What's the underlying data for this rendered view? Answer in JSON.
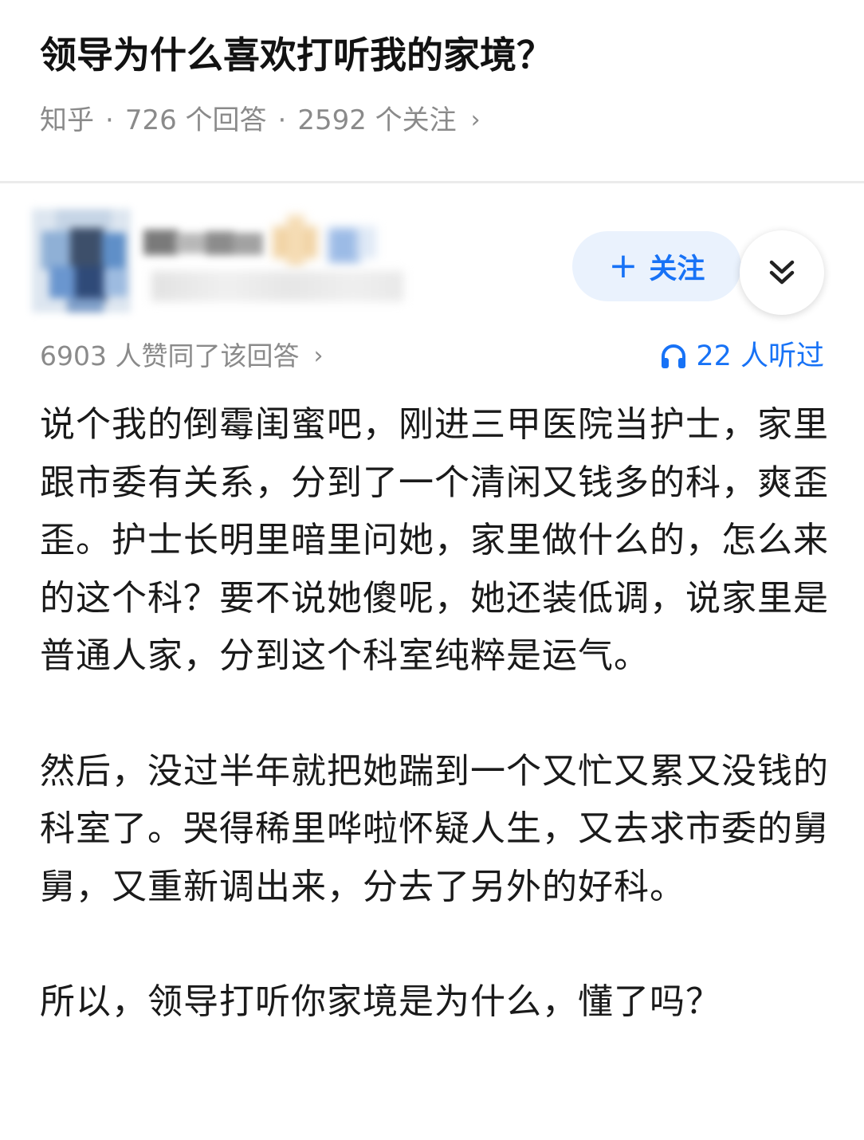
{
  "question": {
    "title": "领导为什么喜欢打听我的家境？",
    "source": "知乎",
    "answers": "726 个回答",
    "followers": "2592 个关注",
    "separator": "·",
    "chevron": "›"
  },
  "author": {
    "follow_label": "关注",
    "follow_icon": "plus-icon",
    "expand_icon": "double-chevron-down-icon"
  },
  "stats": {
    "votes": "6903 人赞同了该回答",
    "listens": "22 人听过",
    "listen_icon": "headphones-icon",
    "chevron": "›"
  },
  "answer": {
    "paragraphs": [
      "说个我的倒霉闺蜜吧，刚进三甲医院当护士，家里跟市委有关系，分到了一个清闲又钱多的科，爽歪歪。护士长明里暗里问她，家里做什么的，怎么来的这个科？要不说她傻呢，她还装低调，说家里是普通人家，分到这个科室纯粹是运气。",
      "然后，没过半年就把她踹到一个又忙又累又没钱的科室了。哭得稀里哗啦怀疑人生，又去求市委的舅舅，又重新调出来，分去了另外的好科。",
      "所以，领导打听你家境是为什么，懂了吗？"
    ]
  },
  "colors": {
    "accent": "#1772f6",
    "follow_bg": "#eaf2fd",
    "meta_text": "#8a8a8a",
    "divider": "#ebebeb"
  }
}
